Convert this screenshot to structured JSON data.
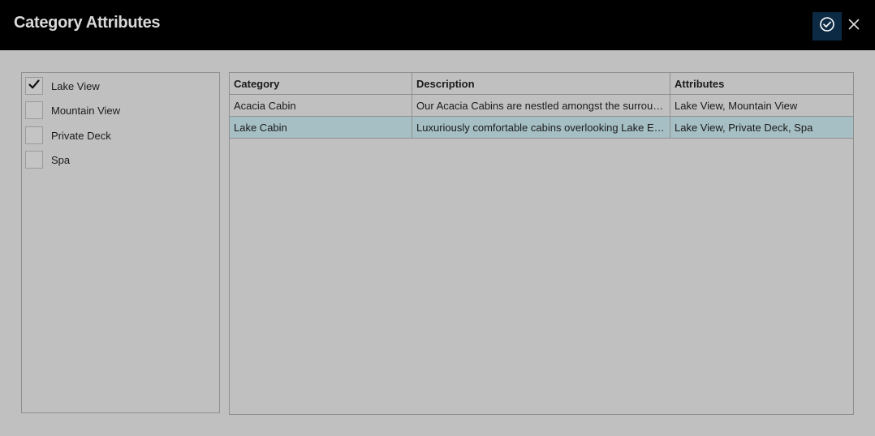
{
  "window": {
    "title": "Category Attributes",
    "confirm_icon": "check-circle-icon",
    "close_icon": "close-icon"
  },
  "attributes": [
    {
      "label": "Lake View",
      "checked": true
    },
    {
      "label": "Mountain View",
      "checked": false
    },
    {
      "label": "Private Deck",
      "checked": false
    },
    {
      "label": "Spa",
      "checked": false
    }
  ],
  "grid": {
    "columns": [
      "Category",
      "Description",
      "Attributes"
    ],
    "rows": [
      {
        "category": "Acacia Cabin",
        "description": "Our Acacia Cabins are nestled amongst the surrou…",
        "attributes": "Lake View, Mountain View",
        "selected": false
      },
      {
        "category": "Lake Cabin",
        "description": "Luxuriously comfortable cabins overlooking Lake E…",
        "attributes": "Lake View, Private Deck, Spa",
        "selected": true
      }
    ]
  },
  "colors": {
    "header_bg": "#000000",
    "background": "#c0c0c0",
    "confirm_bg": "#0c2a44",
    "selected_row": "#a6bfc4"
  }
}
